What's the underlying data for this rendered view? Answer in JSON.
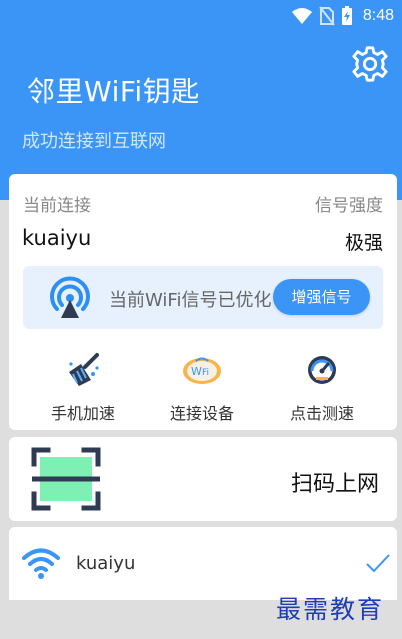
{
  "status": {
    "time": "8:48"
  },
  "header": {
    "title": "邻里WiFi钥匙",
    "subtitle": "成功连接到互联网",
    "settings_icon": "gear-icon"
  },
  "connection": {
    "current_label": "当前连接",
    "signal_label": "信号强度",
    "network_name": "kuaiyu",
    "signal_value": "极强",
    "notice_text": "当前WiFi信号已优化",
    "boost_button": "增强信号"
  },
  "quick_actions": [
    {
      "label": "手机加速",
      "icon": "broom-icon"
    },
    {
      "label": "连接设备",
      "icon": "wifi-device-icon"
    },
    {
      "label": "点击测速",
      "icon": "speedometer-icon"
    }
  ],
  "scan": {
    "label": "扫码上网",
    "icon": "qr-scan-icon"
  },
  "wifi_list": [
    {
      "name": "kuaiyu",
      "connected": true
    }
  ],
  "watermark": "最需教育",
  "colors": {
    "accent": "#3a95f6",
    "notice_bg": "#e7f1fd",
    "scan_fill": "#7ef0b4"
  }
}
